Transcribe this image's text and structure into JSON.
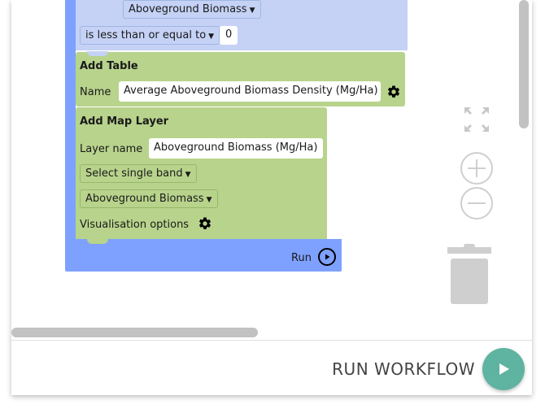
{
  "filter_block": {
    "band_dropdown": "Aboveground Biomass",
    "operator_dropdown": "is less than or equal to",
    "value": "0"
  },
  "add_table": {
    "title": "Add Table",
    "name_label": "Name",
    "name_value": "Average Aboveground Biomass Density (Mg/Ha)"
  },
  "add_map_layer": {
    "title": "Add Map Layer",
    "layer_name_label": "Layer name",
    "layer_name_value": "Aboveground Biomass (Mg/Ha)",
    "band_mode_dropdown": "Select single band",
    "band_dropdown": "Aboveground Biomass",
    "vis_options_label": "Visualisation options"
  },
  "run_block": {
    "label": "Run"
  },
  "footer": {
    "run_workflow_label": "RUN WORKFLOW"
  },
  "icons": {
    "fullscreen": "fullscreen-icon",
    "zoom_in": "zoom-in-icon",
    "zoom_out": "zoom-out-icon",
    "trash": "trash-icon",
    "gear": "gear-icon",
    "play": "play-icon"
  },
  "colors": {
    "blue_block": "#7ea1ff",
    "light_blue_block": "#c5d2f6",
    "green_block": "#b8d38c",
    "run_button": "#5fb3a1"
  }
}
